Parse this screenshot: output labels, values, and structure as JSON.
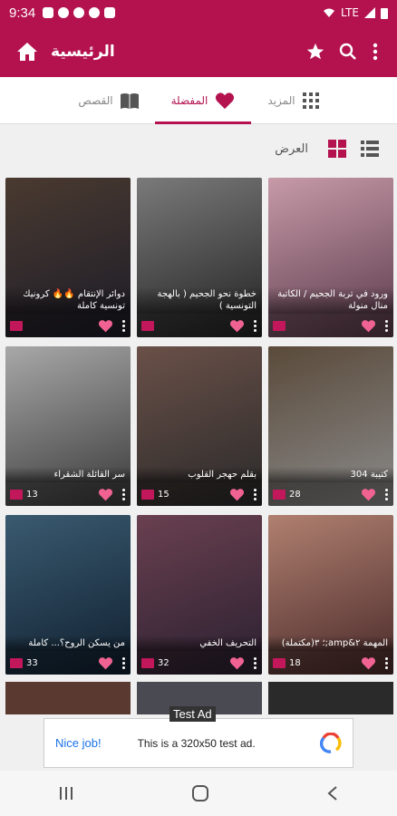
{
  "status": {
    "time": "9:34",
    "network": "LTE",
    "battery": "battery-icon"
  },
  "appbar": {
    "title": "الرئيسية",
    "home_icon": "home-icon",
    "star_icon": "star-icon",
    "search_icon": "search-icon",
    "more_icon": "more-vert-icon",
    "color": "#b3124f"
  },
  "tabs": [
    {
      "label": "القصص",
      "icon": "book-icon",
      "active": false
    },
    {
      "label": "المفضلة",
      "icon": "heart-icon",
      "active": true
    },
    {
      "label": "المزيد",
      "icon": "grid-dots-icon",
      "active": false
    }
  ],
  "view": {
    "label": "العرض"
  },
  "stories": [
    {
      "title": "ورود في تربة الجحيم / الكاتبة منال منولة",
      "count": "",
      "cover": [
        "#5a3a4a",
        "#c79aa8"
      ]
    },
    {
      "title": "خطوة نحو الجحيم ( بالهجة التونسية )",
      "count": "",
      "cover": [
        "#222222",
        "#7a7a7a"
      ]
    },
    {
      "title": "دوائر الإنتقام 🔥🔥 كرونيك تونسية كاملة",
      "count": "",
      "cover": [
        "#1c1c28",
        "#4a3a30"
      ]
    },
    {
      "title": "كتيبة 304",
      "count": "28",
      "cover": [
        "#8a8a8a",
        "#5a4a3a"
      ]
    },
    {
      "title": "بقلم حهجر القلوب",
      "count": "15",
      "cover": [
        "#2a2a2a",
        "#6a5048"
      ]
    },
    {
      "title": "سر القائلة الشقراء",
      "count": "13",
      "cover": [
        "#3a3a3a",
        "#a8a8a8"
      ]
    },
    {
      "title": "المهمة ٢&amp;؛ ٣(مكتملة)",
      "count": "18",
      "cover": [
        "#4a2a2a",
        "#b08070"
      ]
    },
    {
      "title": "التحريف الخفي",
      "count": "32",
      "cover": [
        "#2a2030",
        "#6a4050"
      ]
    },
    {
      "title": "من يسكن الروح؟... كاملة",
      "count": "33",
      "cover": [
        "#102030",
        "#3a5a70"
      ]
    }
  ],
  "ad": {
    "tag": "Test Ad",
    "headline": "Nice job!",
    "body": "This is a 320x50 test ad."
  }
}
